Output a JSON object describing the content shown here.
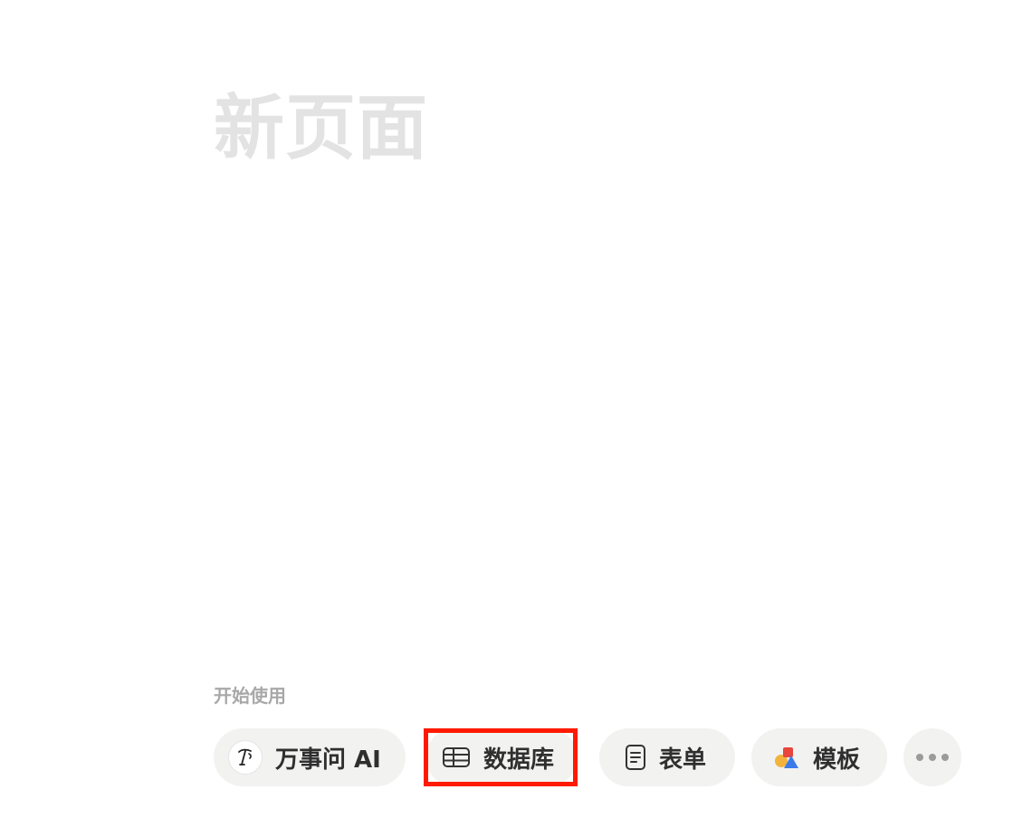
{
  "page": {
    "title": "新页面"
  },
  "get_started": {
    "label": "开始使用",
    "actions": [
      {
        "id": "ai",
        "label": "万事问 AI",
        "icon": "ai-assistant-icon"
      },
      {
        "id": "database",
        "label": "数据库",
        "icon": "table-icon",
        "highlighted": true
      },
      {
        "id": "form",
        "label": "表单",
        "icon": "form-document-icon"
      },
      {
        "id": "templates",
        "label": "模板",
        "icon": "shapes-icon"
      },
      {
        "id": "more",
        "label": "",
        "icon": "more-dots-icon"
      }
    ]
  },
  "colors": {
    "title": "#e3e3e3",
    "section_label": "#a8a8a8",
    "pill_bg": "#f2f2f1",
    "highlight": "#ff1a00",
    "template_yellow": "#f2b33d",
    "template_red": "#e8453c",
    "template_blue": "#3b7be8"
  }
}
